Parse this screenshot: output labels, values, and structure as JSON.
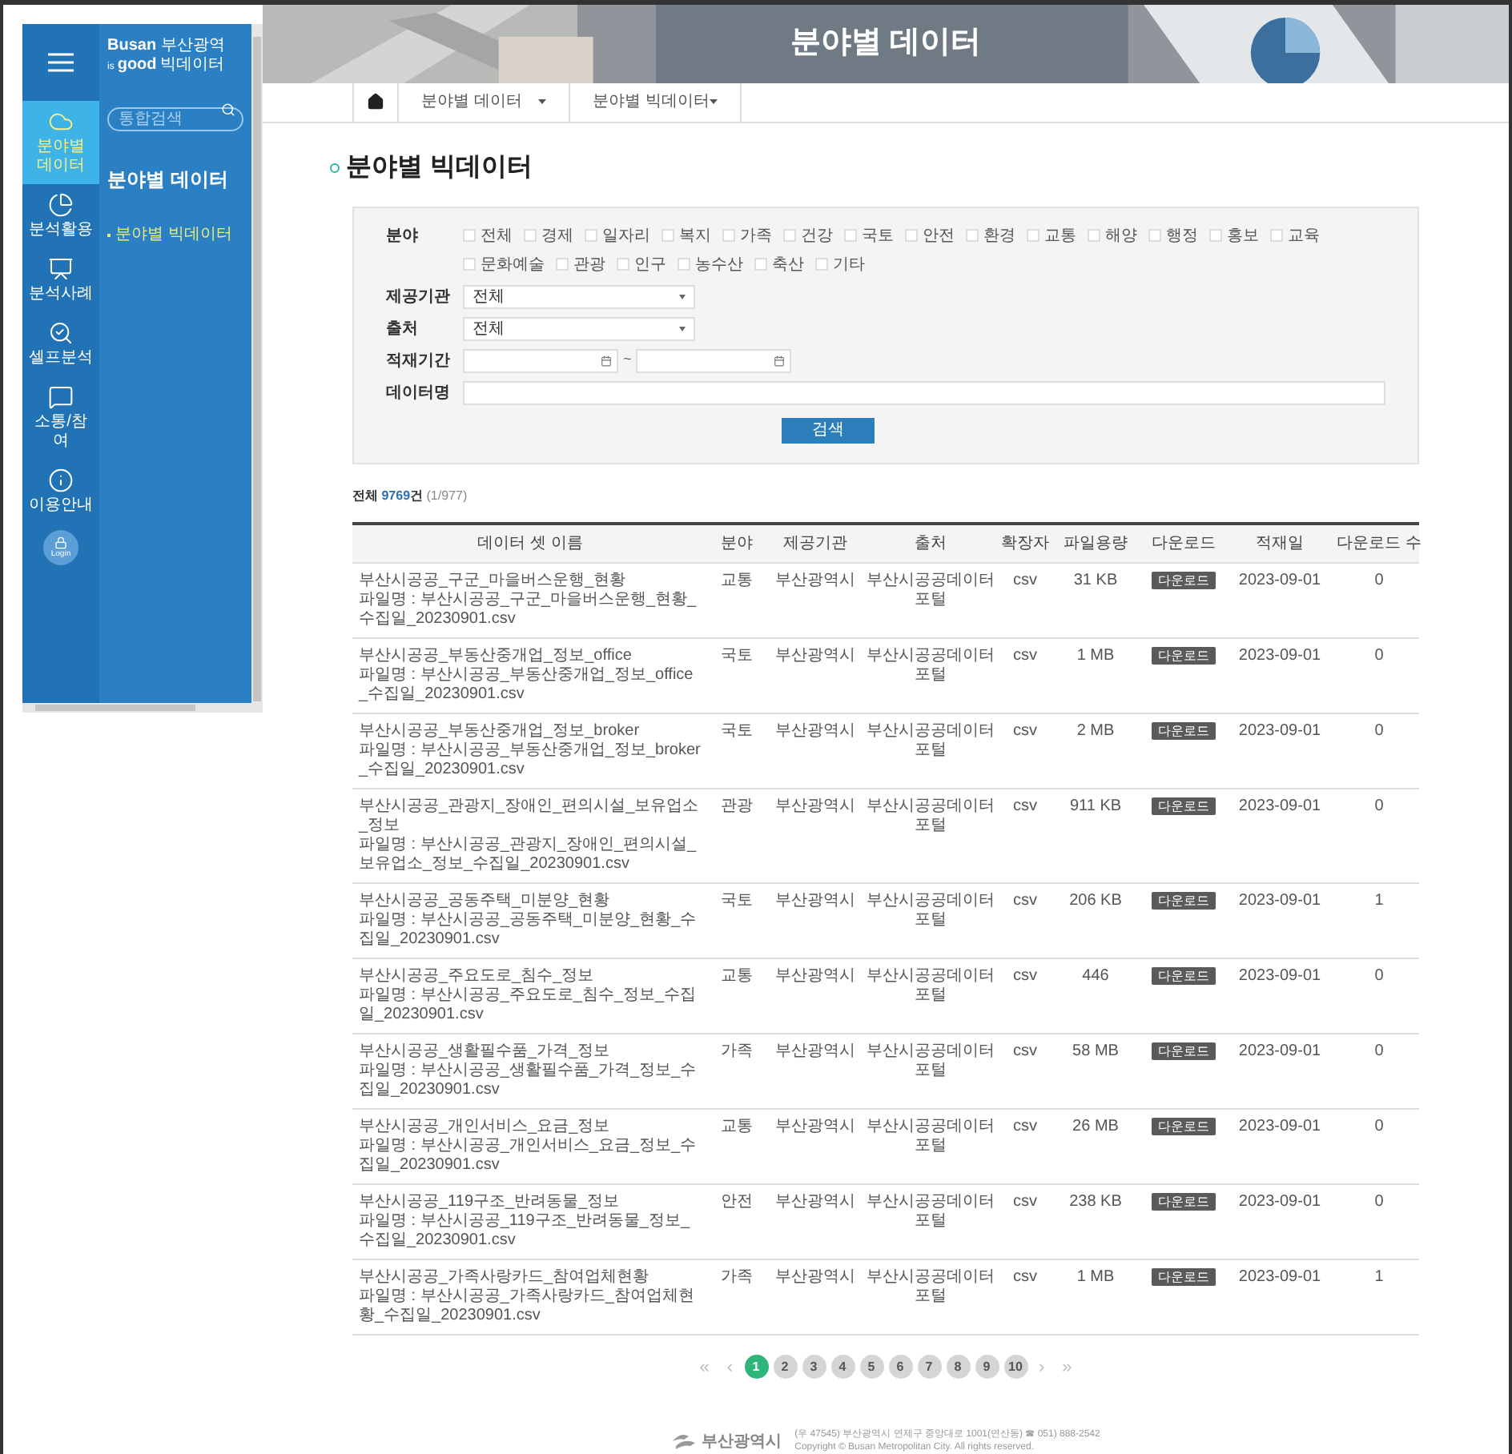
{
  "sidebar": {
    "logo": {
      "top_en": "Busan",
      "top_ko": "부산광역",
      "bottom_small": "is",
      "bottom_en": "good",
      "bottom_ko": "빅데이터"
    },
    "nav": [
      {
        "label": "분야별 데이터",
        "selected": true
      },
      {
        "label": "분석활용",
        "selected": false
      },
      {
        "label": "분석사례",
        "selected": false
      },
      {
        "label": "셀프분석",
        "selected": false
      },
      {
        "label": "소통/참여",
        "selected": false
      },
      {
        "label": "이용안내",
        "selected": false
      }
    ],
    "login": "Login",
    "search": {
      "placeholder": "통합검색"
    },
    "section_title": "분야별 데이터",
    "submenu": [
      {
        "label": "분야별 빅데이터",
        "selected": true
      }
    ]
  },
  "banner": {
    "title": "분야별 데이터"
  },
  "breadcrumb": [
    "분야별 데이터",
    "분야별 빅데이터"
  ],
  "page_title": "분야별 빅데이터",
  "search_form": {
    "fields": [
      {
        "label": "분야",
        "kind": "checkboxes",
        "options": [
          {
            "label": "전체",
            "checked": false
          },
          {
            "label": "경제",
            "checked": false
          },
          {
            "label": "일자리",
            "checked": false
          },
          {
            "label": "복지",
            "checked": false
          },
          {
            "label": "가족",
            "checked": false
          },
          {
            "label": "건강",
            "checked": false
          },
          {
            "label": "국토",
            "checked": false
          },
          {
            "label": "안전",
            "checked": false
          },
          {
            "label": "환경",
            "checked": false
          },
          {
            "label": "교통",
            "checked": false
          },
          {
            "label": "해양",
            "checked": false
          },
          {
            "label": "행정",
            "checked": false
          },
          {
            "label": "홍보",
            "checked": false
          },
          {
            "label": "교육",
            "checked": false
          },
          {
            "label": "문화예술",
            "checked": false
          },
          {
            "label": "관광",
            "checked": false
          },
          {
            "label": "인구",
            "checked": false
          },
          {
            "label": "농수산",
            "checked": false
          },
          {
            "label": "축산",
            "checked": false
          },
          {
            "label": "기타",
            "checked": false
          }
        ]
      },
      {
        "label": "제공기관",
        "kind": "select",
        "value": "전체"
      },
      {
        "label": "출처",
        "kind": "select",
        "value": "전체"
      },
      {
        "label": "적재기간",
        "kind": "daterange",
        "separator": "~"
      },
      {
        "label": "데이터명",
        "kind": "text"
      }
    ],
    "button": "검색"
  },
  "summary": {
    "prefix": "전체",
    "count": "9769",
    "suffix": "건",
    "pages": "(1/977)"
  },
  "table": {
    "columns": [
      "데이터 셋 이름",
      "분야",
      "제공기관",
      "출처",
      "확장자",
      "파일용량",
      "다운로드",
      "적재일",
      "다운로드 수"
    ],
    "rows": [
      {
        "title": "부산시공공_구군_마을버스운행_현황",
        "filename": "파일명 : 부산시공공_구군_마을버스운행_현황_수집일_20230901.csv",
        "field": "교통",
        "provider": "부산광역시",
        "source": "부산시공공데이터 포털",
        "ext": "csv",
        "size": "31 KB",
        "download": "다운로드",
        "date": "2023-09-01",
        "downloads": "0"
      },
      {
        "title": "부산시공공_부동산중개업_정보_office",
        "filename": "파일명 : 부산시공공_부동산중개업_정보_office_수집일_20230901.csv",
        "field": "국토",
        "provider": "부산광역시",
        "source": "부산시공공데이터 포털",
        "ext": "csv",
        "size": "1 MB",
        "download": "다운로드",
        "date": "2023-09-01",
        "downloads": "0"
      },
      {
        "title": "부산시공공_부동산중개업_정보_broker",
        "filename": "파일명 : 부산시공공_부동산중개업_정보_broker_수집일_20230901.csv",
        "field": "국토",
        "provider": "부산광역시",
        "source": "부산시공공데이터 포털",
        "ext": "csv",
        "size": "2 MB",
        "download": "다운로드",
        "date": "2023-09-01",
        "downloads": "0"
      },
      {
        "title": "부산시공공_관광지_장애인_편의시설_보유업소_정보",
        "filename": "파일명 : 부산시공공_관광지_장애인_편의시설_보유업소_정보_수집일_20230901.csv",
        "field": "관광",
        "provider": "부산광역시",
        "source": "부산시공공데이터 포털",
        "ext": "csv",
        "size": "911 KB",
        "download": "다운로드",
        "date": "2023-09-01",
        "downloads": "0"
      },
      {
        "title": "부산시공공_공동주택_미분양_현황",
        "filename": "파일명 : 부산시공공_공동주택_미분양_현황_수집일_20230901.csv",
        "field": "국토",
        "provider": "부산광역시",
        "source": "부산시공공데이터 포털",
        "ext": "csv",
        "size": "206 KB",
        "download": "다운로드",
        "date": "2023-09-01",
        "downloads": "1"
      },
      {
        "title": "부산시공공_주요도로_침수_정보",
        "filename": "파일명 : 부산시공공_주요도로_침수_정보_수집일_20230901.csv",
        "field": "교통",
        "provider": "부산광역시",
        "source": "부산시공공데이터 포털",
        "ext": "csv",
        "size": "446",
        "download": "다운로드",
        "date": "2023-09-01",
        "downloads": "0"
      },
      {
        "title": "부산시공공_생활필수품_가격_정보",
        "filename": "파일명 : 부산시공공_생활필수품_가격_정보_수집일_20230901.csv",
        "field": "가족",
        "provider": "부산광역시",
        "source": "부산시공공데이터 포털",
        "ext": "csv",
        "size": "58 MB",
        "download": "다운로드",
        "date": "2023-09-01",
        "downloads": "0"
      },
      {
        "title": "부산시공공_개인서비스_요금_정보",
        "filename": "파일명 : 부산시공공_개인서비스_요금_정보_수집일_20230901.csv",
        "field": "교통",
        "provider": "부산광역시",
        "source": "부산시공공데이터 포털",
        "ext": "csv",
        "size": "26 MB",
        "download": "다운로드",
        "date": "2023-09-01",
        "downloads": "0"
      },
      {
        "title": "부산시공공_119구조_반려동물_정보",
        "filename": "파일명 : 부산시공공_119구조_반려동물_정보_수집일_20230901.csv",
        "field": "안전",
        "provider": "부산광역시",
        "source": "부산시공공데이터 포털",
        "ext": "csv",
        "size": "238 KB",
        "download": "다운로드",
        "date": "2023-09-01",
        "downloads": "0"
      },
      {
        "title": "부산시공공_가족사랑카드_참여업체현황",
        "filename": "파일명 : 부산시공공_가족사랑카드_참여업체현황_수집일_20230901.csv",
        "field": "가족",
        "provider": "부산광역시",
        "source": "부산시공공데이터 포털",
        "ext": "csv",
        "size": "1 MB",
        "download": "다운로드",
        "date": "2023-09-01",
        "downloads": "1"
      }
    ]
  },
  "pagination": {
    "first": "«",
    "prev": "‹",
    "pages": [
      {
        "label": "1",
        "selected": true
      },
      {
        "label": "2",
        "selected": false
      },
      {
        "label": "3",
        "selected": false
      },
      {
        "label": "4",
        "selected": false
      },
      {
        "label": "5",
        "selected": false
      },
      {
        "label": "6",
        "selected": false
      },
      {
        "label": "7",
        "selected": false
      },
      {
        "label": "8",
        "selected": false
      },
      {
        "label": "9",
        "selected": false
      },
      {
        "label": "10",
        "selected": false
      }
    ],
    "next": "›",
    "last": "»"
  },
  "footer": {
    "logo": "부산광역시",
    "address": "(우 47545) 부산광역시 연제구 중앙대로 1001(연산동) ☎ 051) 888-2542",
    "copyright": "Copyright © Busan Metropolitan City. All rights reserved."
  }
}
